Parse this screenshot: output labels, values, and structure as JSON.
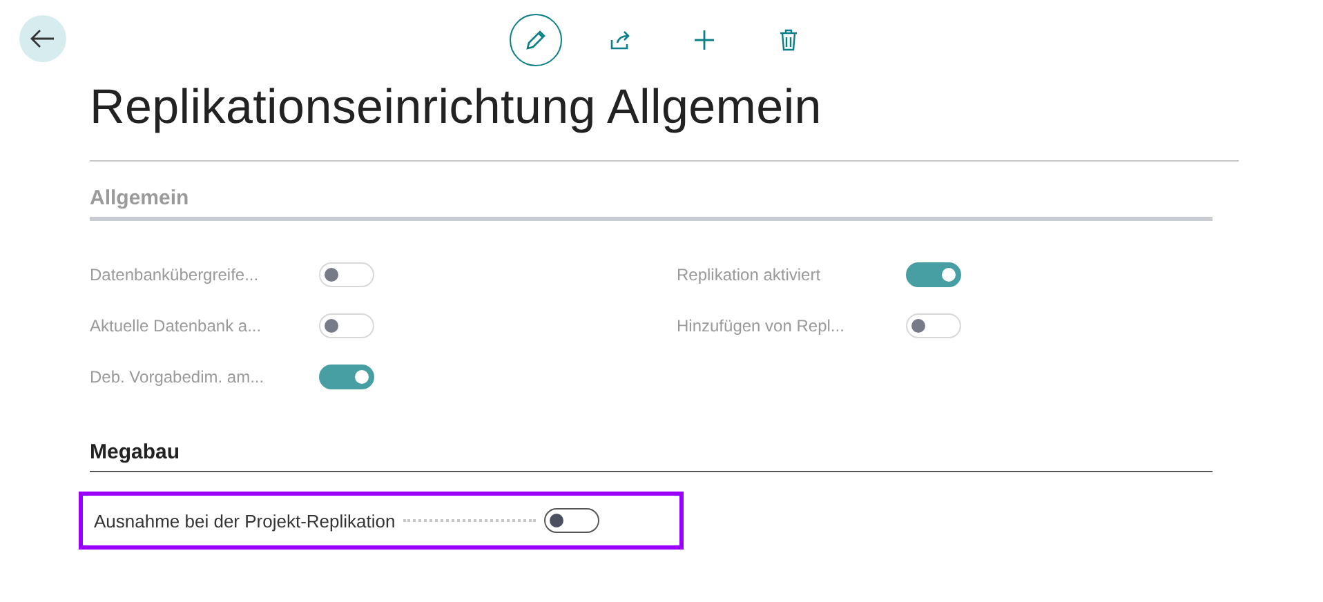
{
  "toolbar": {
    "actions": [
      {
        "kind": "edit",
        "selected": true
      },
      {
        "kind": "share",
        "selected": false
      },
      {
        "kind": "new",
        "selected": false
      },
      {
        "kind": "delete",
        "selected": false
      }
    ]
  },
  "title": "Replikationseinrichtung Allgemein",
  "sections": [
    {
      "title": "Allgemein",
      "dimmed": true,
      "columns": [
        {
          "fields": [
            {
              "label": "Datenbankübergreife...",
              "on": false
            },
            {
              "label": "Aktuelle Datenbank a...",
              "on": false
            },
            {
              "label": "Deb. Vorgabedim. am...",
              "on": true
            }
          ]
        },
        {
          "fields": [
            {
              "label": "Replikation aktiviert",
              "on": true
            },
            {
              "label": "Hinzufügen von Repl...",
              "on": false
            }
          ]
        }
      ]
    },
    {
      "title": "Megabau",
      "dimmed": false,
      "columns": [
        {
          "fields": [
            {
              "label": "Ausnahme bei der Projekt-Replikation",
              "on": false,
              "highlighted": true
            }
          ]
        }
      ]
    }
  ]
}
